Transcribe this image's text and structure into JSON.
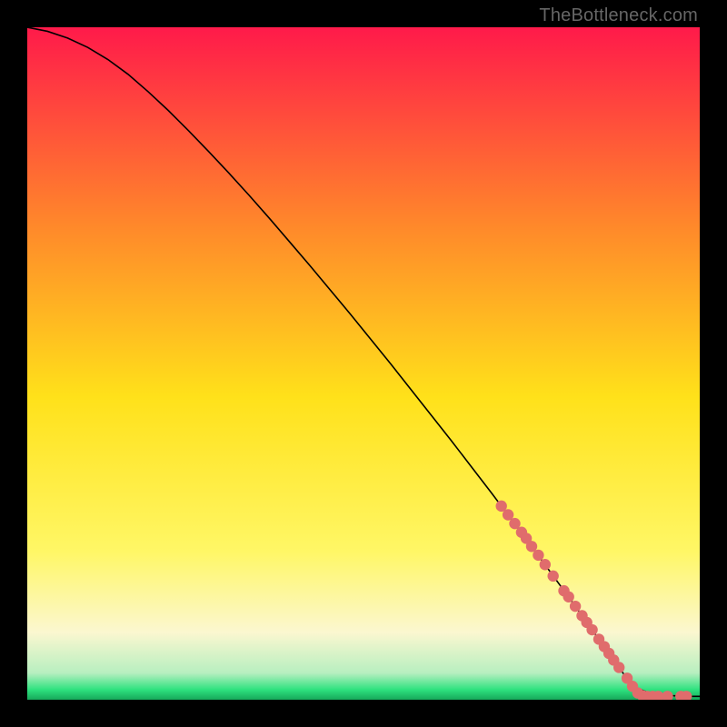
{
  "watermark": "TheBottleneck.com",
  "colors": {
    "frame": "#000000",
    "gradient_top": "#ff1a4a",
    "gradient_upper_mid": "#ff8a2a",
    "gradient_mid": "#ffe11a",
    "gradient_lower_mid": "#fff766",
    "gradient_cream": "#fbf7d0",
    "gradient_green": "#2ee27f",
    "curve": "#000000",
    "marker": "#e06c6c",
    "watermark": "#666666"
  },
  "chart_data": {
    "type": "line",
    "title": "",
    "xlabel": "",
    "ylabel": "",
    "xlim": [
      0,
      100
    ],
    "ylim": [
      0,
      100
    ],
    "series": [
      {
        "name": "curve",
        "x": [
          0,
          3,
          6,
          9,
          12,
          15,
          18,
          21,
          24,
          27,
          30,
          33,
          36,
          39,
          42,
          45,
          48,
          51,
          54,
          57,
          60,
          63,
          66,
          69,
          72,
          75,
          78,
          81,
          84,
          87,
          90,
          92,
          94,
          96,
          98,
          100
        ],
        "y": [
          100,
          99.4,
          98.4,
          97.0,
          95.2,
          93.0,
          90.4,
          87.6,
          84.6,
          81.5,
          78.3,
          75.0,
          71.6,
          68.1,
          64.6,
          61.0,
          57.4,
          53.7,
          50.0,
          46.2,
          42.4,
          38.6,
          34.7,
          30.8,
          26.8,
          22.8,
          18.7,
          14.6,
          10.4,
          6.2,
          2.0,
          1.2,
          0.8,
          0.6,
          0.5,
          0.5
        ]
      }
    ],
    "markers": [
      {
        "x": 70.5,
        "y": 28.8
      },
      {
        "x": 71.5,
        "y": 27.5
      },
      {
        "x": 72.5,
        "y": 26.2
      },
      {
        "x": 73.5,
        "y": 24.9
      },
      {
        "x": 74.2,
        "y": 24.0
      },
      {
        "x": 75.0,
        "y": 22.8
      },
      {
        "x": 76.0,
        "y": 21.5
      },
      {
        "x": 77.0,
        "y": 20.1
      },
      {
        "x": 78.2,
        "y": 18.4
      },
      {
        "x": 79.8,
        "y": 16.2
      },
      {
        "x": 80.5,
        "y": 15.3
      },
      {
        "x": 81.5,
        "y": 13.9
      },
      {
        "x": 82.5,
        "y": 12.5
      },
      {
        "x": 83.2,
        "y": 11.5
      },
      {
        "x": 84.0,
        "y": 10.4
      },
      {
        "x": 85.0,
        "y": 9.0
      },
      {
        "x": 85.8,
        "y": 7.9
      },
      {
        "x": 86.5,
        "y": 6.9
      },
      {
        "x": 87.2,
        "y": 5.9
      },
      {
        "x": 88.0,
        "y": 4.8
      },
      {
        "x": 89.2,
        "y": 3.2
      },
      {
        "x": 90.0,
        "y": 2.0
      },
      {
        "x": 90.8,
        "y": 1.0
      },
      {
        "x": 91.5,
        "y": 0.6
      },
      {
        "x": 92.2,
        "y": 0.5
      },
      {
        "x": 93.0,
        "y": 0.5
      },
      {
        "x": 93.8,
        "y": 0.5
      },
      {
        "x": 95.2,
        "y": 0.5
      },
      {
        "x": 97.2,
        "y": 0.5
      },
      {
        "x": 98.0,
        "y": 0.5
      }
    ]
  }
}
